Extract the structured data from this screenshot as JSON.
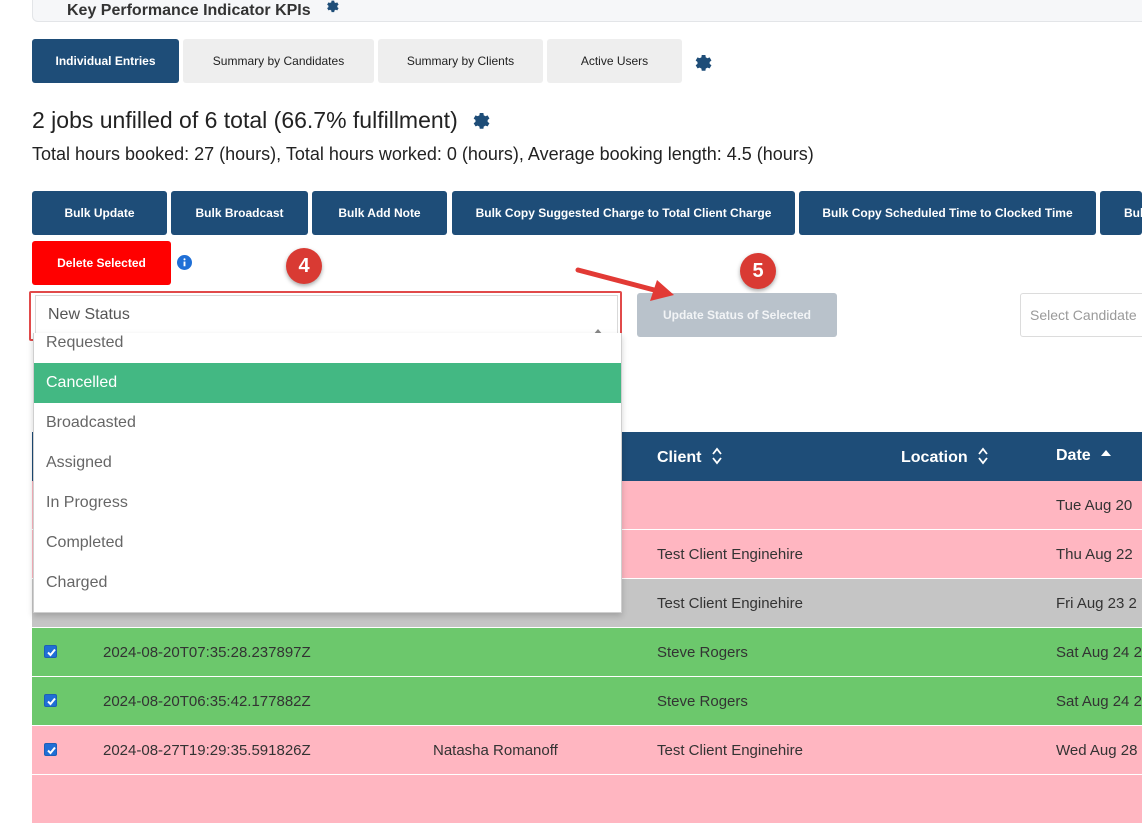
{
  "kpi": {
    "title": "Key Performance Indicator KPIs"
  },
  "tabs": [
    {
      "label": "Individual Entries",
      "active": true
    },
    {
      "label": "Summary by Candidates",
      "active": false
    },
    {
      "label": "Summary by Clients",
      "active": false
    },
    {
      "label": "Active Users",
      "active": false
    }
  ],
  "summary": {
    "title": "2 jobs unfilled of 6 total (66.7% fulfillment)",
    "hours": "Total hours booked: 27 (hours), Total hours worked: 0 (hours), Average booking length: 4.5 (hours)"
  },
  "bulk_actions": [
    "Bulk Update",
    "Bulk Broadcast",
    "Bulk Add Note",
    "Bulk Copy Suggested Charge to Total Client Charge",
    "Bulk Copy Scheduled Time to Clocked Time",
    "Bul"
  ],
  "delete_label": "Delete Selected",
  "annotations": {
    "step4": "4",
    "step5": "5"
  },
  "status_select": {
    "value": "New Status",
    "options": [
      "Requested",
      "Cancelled",
      "Broadcasted",
      "Assigned",
      "In Progress",
      "Completed",
      "Charged"
    ],
    "highlighted": "Cancelled"
  },
  "update_label": "Update Status of Selected",
  "candidate_placeholder": "Select Candidate",
  "table": {
    "headers": {
      "client": "Client",
      "location": "Location",
      "date": "Date"
    },
    "rows": [
      {
        "id": "",
        "candidate": "",
        "client": "",
        "date": "Tue Aug 20",
        "status": "pink",
        "checked": false
      },
      {
        "id": "",
        "candidate": "",
        "client": "Test Client Enginehire",
        "date": "Thu Aug 22",
        "status": "pink",
        "checked": false
      },
      {
        "id": "",
        "candidate": "",
        "client": "Test Client Enginehire",
        "date": "Fri Aug 23 2",
        "status": "gray",
        "checked": false
      },
      {
        "id": "2024-08-20T07:35:28.237897Z",
        "candidate": "",
        "client": "Steve Rogers",
        "date": "Sat Aug 24 2",
        "status": "green",
        "checked": true
      },
      {
        "id": "2024-08-20T06:35:42.177882Z",
        "candidate": "",
        "client": "Steve Rogers",
        "date": "Sat Aug 24 2",
        "status": "green",
        "checked": true
      },
      {
        "id": "2024-08-27T19:29:35.591826Z",
        "candidate": "Natasha Romanoff",
        "client": "Test Client Enginehire",
        "date": "Wed Aug 28",
        "status": "pink",
        "checked": true
      }
    ]
  },
  "colors": {
    "primary": "#1e4d78",
    "danger": "#ff0000",
    "highlight": "#43b883",
    "row_pink": "#ffb6c1",
    "row_gray": "#c5c5c5",
    "row_green": "#6cc86c",
    "annotation_red": "#d93a33"
  }
}
